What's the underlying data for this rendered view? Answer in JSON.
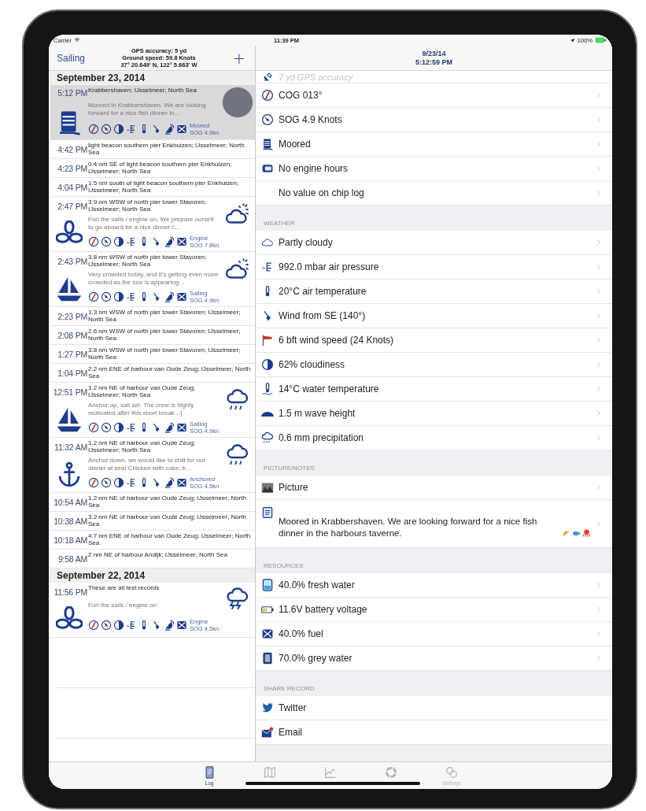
{
  "status_bar": {
    "carrier": "Carrier",
    "time": "11:39 PM",
    "battery": "100%"
  },
  "log_panel": {
    "nav": {
      "back": "Sailing",
      "info": [
        "GPS accuracy: 5 yd",
        "Ground speed: 59.8 Knots",
        "37° 20.649' N, 122° 5.663' W"
      ],
      "add": "+"
    },
    "sections": [
      {
        "title": "September 23, 2014",
        "entries": [
          {
            "time": "5:12 PM",
            "location": "Krabbershaven; IJsselmeer; North Sea",
            "note": "Moored in Krabbershaven. We are looking forward for a nice fish dinner in…",
            "kind": "moored",
            "status": "Moored",
            "speed": "SOG 4.9kn",
            "selected": true
          },
          {
            "time": "4:42 PM",
            "location": "light beacon southern pier Enkhuizen; IJsselmeer; North Sea",
            "kind": "position",
            "selected": false
          },
          {
            "time": "4:23 PM",
            "location": "0.4 nm SE of light beacon southern pier Enkhuizen; IJsselmeer; North Sea",
            "kind": "position",
            "selected": false
          },
          {
            "time": "4:04 PM",
            "location": "1.5 nm south of light beacon southern pier Enkhuizen; IJsselmeer; North Sea",
            "kind": "position",
            "selected": false
          },
          {
            "time": "2:47 PM",
            "location": "3.9 nm WSW of north pier tower Stavoren; IJsselmeer; North Sea",
            "note": "Furl the sails / engine on. We prepare ourself to go aboard for a nice dinner t…",
            "kind": "engine",
            "status": "Engine",
            "speed": "SOG 7.8kn",
            "selected": false
          },
          {
            "time": "2:43 PM",
            "location": "3.8 nm WSW of north pier tower Stavoren; IJsselmeer; North Sea",
            "note": "Very crowded today, and it's getting even more crowded as the sun is appearing…",
            "kind": "sailing",
            "status": "Sailing",
            "speed": "SOG 4.9kn",
            "selected": false
          },
          {
            "time": "2:23 PM",
            "location": "1.3 nm WSW of north pier tower Stavoren; IJsselmeer; North Sea",
            "kind": "position",
            "selected": false
          },
          {
            "time": "2:08 PM",
            "location": "2.6 nm WSW of north pier tower Stavoren; IJsselmeer; North Sea",
            "kind": "position",
            "selected": false
          },
          {
            "time": "1:27 PM",
            "location": "3.8 nm WSW of north pier tower Stavoren; IJsselmeer; North Sea",
            "kind": "position",
            "selected": false
          },
          {
            "time": "1:04 PM",
            "location": "2.2 nm ENE of harbour van Oude Zeug; IJsselmeer; North Sea",
            "kind": "position",
            "selected": false
          },
          {
            "time": "12:51 PM",
            "location": "1.2 nm NE of harbour van Oude Zeug; IJsselmeer; North Sea",
            "note": "Anchor up, sail set. The crew is highly motivated after this short break ;-)",
            "kind": "sailing",
            "status": "Sailing",
            "speed": "SOG 4.9kn",
            "selected": false
          },
          {
            "time": "11:32 AM",
            "location": "1.2 nm NE of harbour van Oude Zeug; IJsselmeer; North Sea",
            "note": "Anchor down, we would like to chill for our dinner at sea! Chicken with coke, b…",
            "kind": "anchored",
            "status": "Anchored",
            "speed": "SOG 4.5kn",
            "selected": false
          },
          {
            "time": "10:54 AM",
            "location": "1.2 nm NE of harbour van Oude Zeug; IJsselmeer; North Sea",
            "kind": "position",
            "selected": false
          },
          {
            "time": "10:38 AM",
            "location": "3.2 nm NE of harbour van Oude Zeug; IJsselmeer; North Sea",
            "kind": "position",
            "selected": false
          },
          {
            "time": "10:18 AM",
            "location": "4.7 nm ENE of harbour van Oude Zeug; IJsselmeer; North Sea",
            "kind": "position",
            "selected": false
          },
          {
            "time": "9:58 AM",
            "location": "2 nm NE of harbour Andijk; IJsselmeer; North Sea",
            "kind": "position",
            "selected": false
          }
        ]
      },
      {
        "title": "September 22, 2014",
        "entries": [
          {
            "time": "11:56 PM",
            "location": "These are all test records",
            "note": "Furl the sails / engine on",
            "kind": "engine",
            "status": "Engine",
            "speed": "SOG 4.5kn",
            "selected": false
          }
        ]
      }
    ]
  },
  "detail_panel": {
    "title": [
      "9/23/14",
      "5:12:59 PM"
    ],
    "sections": [
      {
        "chevrons": true,
        "rows": [
          {
            "label": "7 yd GPS accuracy",
            "faded": true
          },
          {
            "label": "COG 013°",
            "faded": false
          },
          {
            "label": "SOG 4.9 Knots",
            "faded": false
          },
          {
            "label": "Moored",
            "faded": false
          },
          {
            "label": "No engine hours",
            "faded": false
          },
          {
            "label": "No value on chip log",
            "faded": false
          }
        ]
      },
      {
        "title": "WEATHER",
        "chevrons": true,
        "rows": [
          {
            "label": "Partly cloudy"
          },
          {
            "label": "992.0 mbar air pressure"
          },
          {
            "label": "20°C air temperature"
          },
          {
            "label": "Wind from SE (140°)"
          },
          {
            "label": "6 bft wind speed (24 Knots)"
          },
          {
            "label": "62% cloudiness"
          },
          {
            "label": "14°C water temperature"
          },
          {
            "label": "1.5 m wave height"
          },
          {
            "label": "0.6 mm precipitation"
          }
        ]
      },
      {
        "title": "PICTURE/NOTES",
        "chevrons": true,
        "rows": [
          {
            "label": "Picture",
            "kind": "item"
          },
          {
            "label": "Moored in Krabbershaven. We are looking forward for a nice fish dinner in the harbours taverne.",
            "kind": "note"
          }
        ]
      },
      {
        "title": "RESOURCES",
        "chevrons": true,
        "rows": [
          {
            "label": "40.0% fresh water"
          },
          {
            "label": "11.6V battery voltage"
          },
          {
            "label": "40.0% fuel"
          },
          {
            "label": "70.0% grey water"
          }
        ]
      },
      {
        "title": "SHARE RECORD",
        "chevrons": false,
        "rows": [
          {
            "label": "Twitter"
          },
          {
            "label": "Email"
          }
        ]
      }
    ]
  },
  "tab_bar": {
    "tabs": [
      {
        "label": "Log",
        "selected": true
      },
      {
        "selected": false
      },
      {
        "selected": false
      },
      {
        "selected": false
      },
      {
        "label": "Settings",
        "selected": false
      }
    ]
  }
}
